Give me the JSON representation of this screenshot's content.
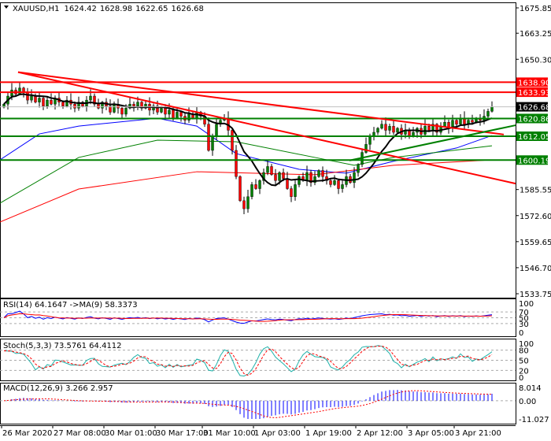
{
  "header": {
    "symbol": "XAUUSD,H1",
    "open": "1624.42",
    "high": "1628.98",
    "low": "1622.65",
    "close": "1626.68"
  },
  "chart_data": {
    "type": "candlestick",
    "symbol": "XAUUSD",
    "timeframe": "H1",
    "closes": [
      1628,
      1632,
      1635,
      1633,
      1636,
      1634,
      1630,
      1632,
      1629,
      1631,
      1627,
      1630,
      1628,
      1631,
      1629,
      1627,
      1630,
      1628,
      1626,
      1629,
      1627,
      1630,
      1632,
      1628,
      1626,
      1629,
      1627,
      1624,
      1628,
      1626,
      1623,
      1626,
      1628,
      1627,
      1629,
      1626,
      1628,
      1625,
      1627,
      1624,
      1626,
      1623,
      1625,
      1621,
      1624,
      1622,
      1620,
      1623,
      1621,
      1624,
      1622,
      1618,
      1605,
      1612,
      1618,
      1620,
      1621,
      1615,
      1605,
      1592,
      1580,
      1576,
      1582,
      1588,
      1586,
      1590,
      1594,
      1597,
      1593,
      1590,
      1594,
      1591,
      1586,
      1582,
      1588,
      1592,
      1590,
      1594,
      1589,
      1592,
      1595,
      1592,
      1590,
      1588,
      1590,
      1586,
      1588,
      1592,
      1589,
      1594,
      1598,
      1604,
      1608,
      1612,
      1614,
      1616,
      1618,
      1615,
      1617,
      1614,
      1616,
      1613,
      1615,
      1612,
      1614,
      1616,
      1613,
      1617,
      1615,
      1618,
      1614,
      1617,
      1619,
      1616,
      1620,
      1618,
      1621,
      1618,
      1620,
      1619,
      1621,
      1620,
      1622,
      1624.42,
      1626.68
    ],
    "moving_averages": [
      {
        "name": "MA-blue",
        "color": "#0000ff",
        "points": [
          [
            -1,
            1600.3
          ],
          [
            9,
            1613.2
          ],
          [
            19,
            1617.1
          ],
          [
            39,
            1621.0
          ],
          [
            49,
            1617.1
          ],
          [
            59,
            1603.4
          ],
          [
            75,
            1595.6
          ],
          [
            87,
            1593.7
          ],
          [
            99,
            1599.6
          ],
          [
            115,
            1606.2
          ],
          [
            124,
            1612.4
          ]
        ]
      },
      {
        "name": "MA-green",
        "color": "#008000",
        "points": [
          [
            -1,
            1578.8
          ],
          [
            19,
            1601.5
          ],
          [
            39,
            1610.1
          ],
          [
            59,
            1609.3
          ],
          [
            79,
            1601.5
          ],
          [
            89,
            1597.6
          ],
          [
            99,
            1601.5
          ],
          [
            124,
            1607.3
          ]
        ]
      },
      {
        "name": "MA-red",
        "color": "#ff0000",
        "points": [
          [
            -1,
            1569.4
          ],
          [
            19,
            1585.8
          ],
          [
            49,
            1594.4
          ],
          [
            79,
            1592.9
          ],
          [
            99,
            1597.6
          ],
          [
            124,
            1600.3
          ]
        ]
      }
    ],
    "levels": [
      {
        "price": "1638.90",
        "color": "#ff0000"
      },
      {
        "price": "1633.93",
        "color": "#ff0000"
      },
      {
        "price": "1620.86",
        "color": "#008000"
      },
      {
        "price": "1612.05",
        "color": "#008000"
      },
      {
        "price": "1600.19",
        "color": "#008000"
      }
    ],
    "current_price": {
      "price": "1626.68",
      "color": "#000000"
    },
    "trendlines": [
      {
        "color": "#ff0000",
        "from": [
          3.6,
          1643.9
        ],
        "to": [
          127,
          1612.9
        ]
      },
      {
        "color": "#ff0000",
        "from": [
          3.6,
          1643.9
        ],
        "to": [
          130,
          1588.5
        ]
      },
      {
        "color": "#008000",
        "from": [
          87.8,
          1600.0
        ],
        "to": [
          130,
          1617.5
        ]
      }
    ],
    "price_axis": [
      "1675.85",
      "1663.25",
      "1650.30",
      "1585.55",
      "1572.60",
      "1559.65",
      "1546.70",
      "1533.75"
    ],
    "ylim": [
      1533.75,
      1675.85
    ],
    "time_axis": [
      {
        "bar": 0,
        "label": "26 Mar 2020"
      },
      {
        "bar": 13,
        "label": "27 Mar 08:00"
      },
      {
        "bar": 26,
        "label": "30 Mar 01:00"
      },
      {
        "bar": 39,
        "label": "30 Mar 17:00"
      },
      {
        "bar": 51,
        "label": "31 Mar 10:00"
      },
      {
        "bar": 64,
        "label": "1 Apr 03:00"
      },
      {
        "bar": 77,
        "label": "1 Apr 19:00"
      },
      {
        "bar": 90,
        "label": "2 Apr 12:00"
      },
      {
        "bar": 103,
        "label": "3 Apr 05:00"
      },
      {
        "bar": 115,
        "label": "3 Apr 21:00"
      }
    ],
    "rsi": {
      "label": "RSI(14) 64.1647  ->MA(9) 58.3373",
      "axis": [
        "100",
        "70",
        "50",
        "30",
        "0"
      ],
      "levels": [
        70,
        50,
        30
      ]
    },
    "stoch": {
      "label": "Stoch(5,3,3) 73.5761 64.4112",
      "axis": [
        "100",
        "80",
        "50",
        "20",
        "0"
      ],
      "levels": [
        80,
        50,
        20
      ]
    },
    "macd": {
      "label": "MACD(12,26,9) 3.266 2.957",
      "axis": [
        "8.014",
        "0.00",
        "-11.027"
      ],
      "max": 8.014,
      "min": -11.027
    }
  }
}
